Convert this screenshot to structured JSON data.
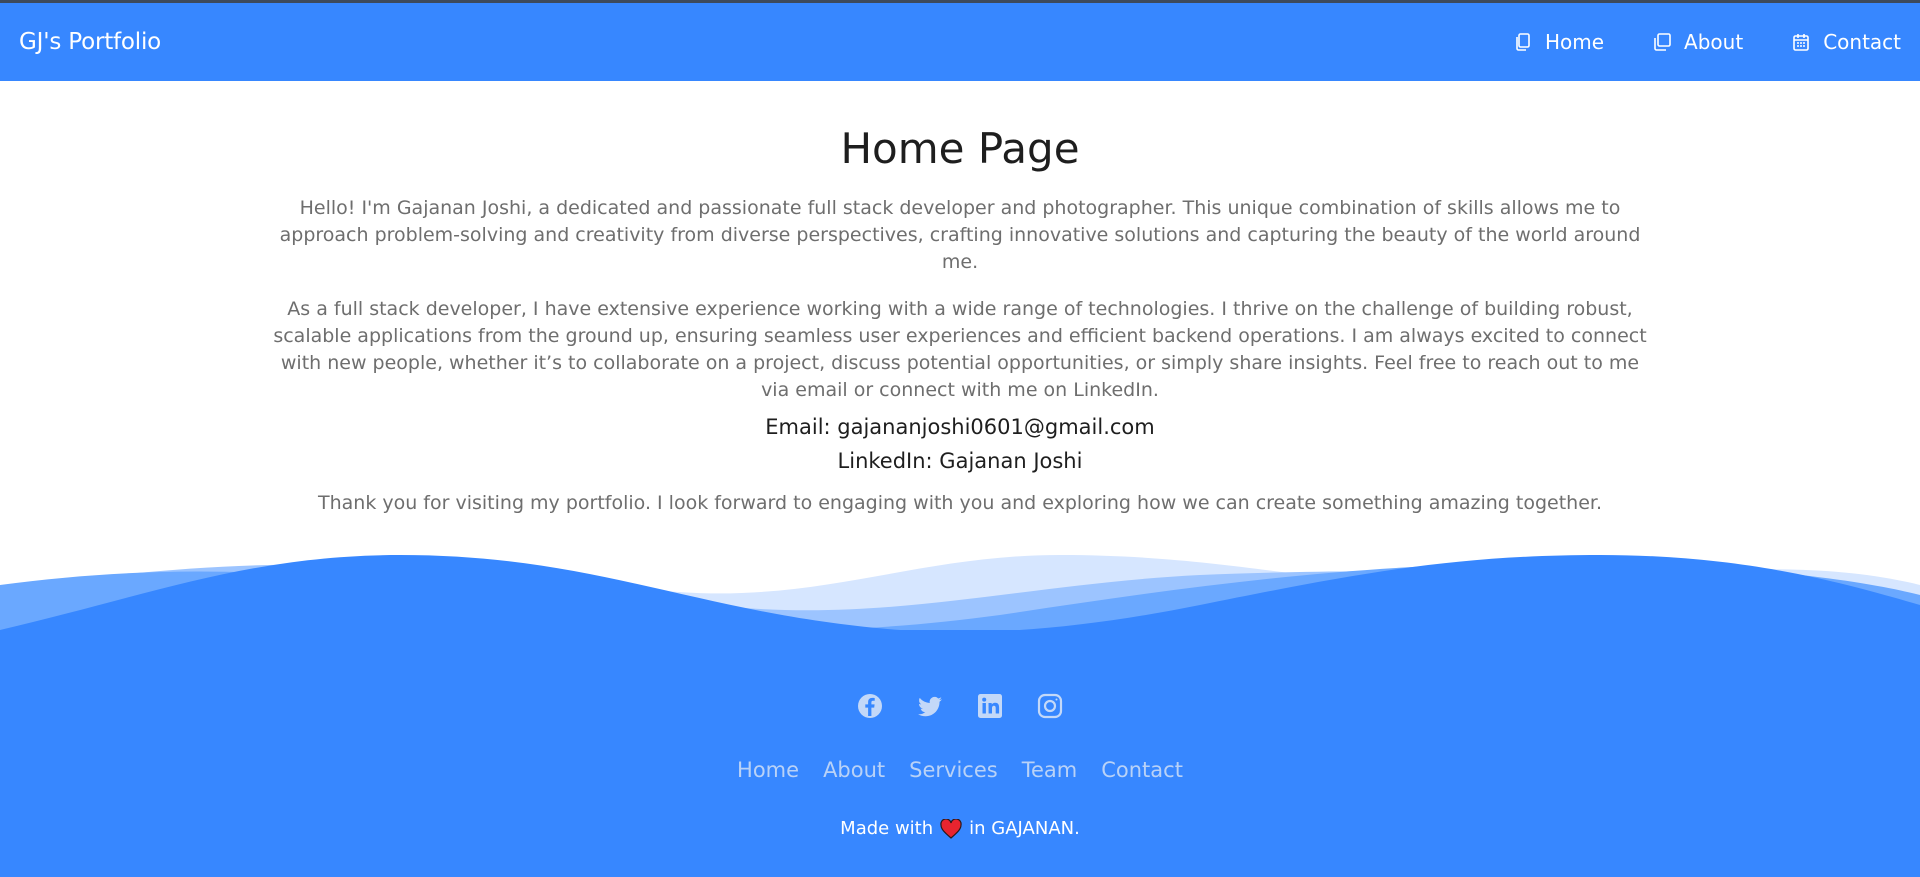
{
  "header": {
    "brand": "GJ's Portfolio",
    "nav": [
      {
        "label": "Home",
        "icon": "copy-icon"
      },
      {
        "label": "About",
        "icon": "window-icon"
      },
      {
        "label": "Contact",
        "icon": "calendar-icon"
      }
    ]
  },
  "main": {
    "title": "Home Page",
    "paragraphs": [
      "Hello! I'm Gajanan Joshi, a dedicated and passionate full stack developer and photographer. This unique combination of skills allows me to approach problem-solving and creativity from diverse perspectives, crafting innovative solutions and capturing the beauty of the world around me.",
      "As a full stack developer, I have extensive experience working with a wide range of technologies. I thrive on the challenge of building robust, scalable applications from the ground up, ensuring seamless user experiences and efficient backend operations. I am always excited to connect with new people, whether it’s to collaborate on a project, discuss potential opportunities, or simply share insights. Feel free to reach out to me via email or connect with me on LinkedIn.",
      "Thank you for visiting my portfolio. I look forward to engaging with you and exploring how we can create something amazing together."
    ],
    "email_line": "Email: gajananjoshi0601@gmail.com",
    "linkedin_line": "LinkedIn: Gajanan Joshi"
  },
  "footer": {
    "social": [
      "facebook-icon",
      "twitter-icon",
      "linkedin-icon",
      "instagram-icon"
    ],
    "links": [
      "Home",
      "About",
      "Services",
      "Team",
      "Contact"
    ],
    "made_with_prefix": "Made with",
    "made_with_suffix": "in GAJANAN."
  },
  "colors": {
    "primary": "#3787ff",
    "footer_link": "#b9d2f7",
    "heart": "#e8242f"
  }
}
